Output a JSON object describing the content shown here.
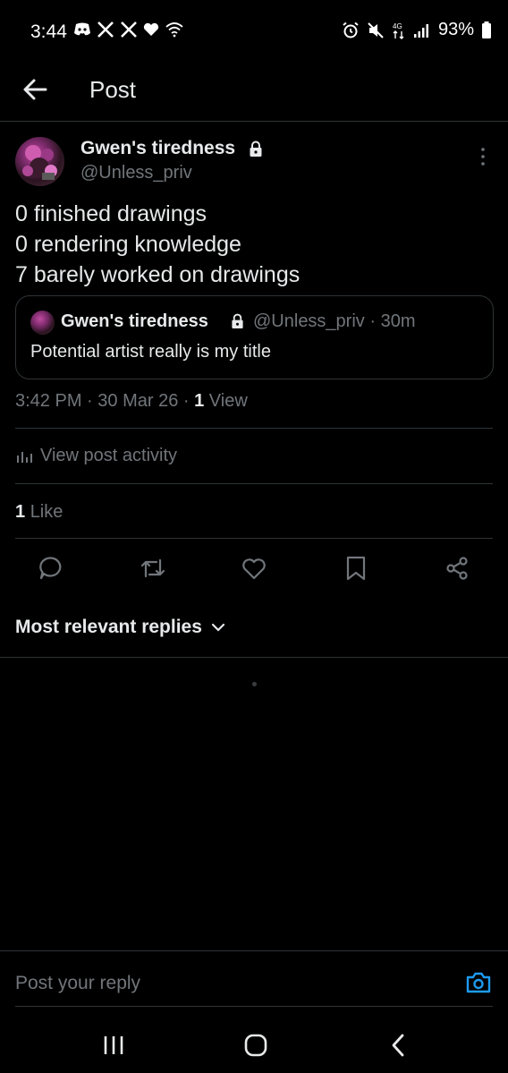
{
  "status_bar": {
    "time": "3:44",
    "battery": "93%",
    "left_icons": [
      "discord-icon",
      "x-icon",
      "x-icon",
      "heart-icon",
      "wifi-icon"
    ],
    "right_icons": [
      "alarm-icon",
      "mute-icon",
      "data-icon",
      "signal-icon",
      "battery-icon"
    ]
  },
  "header": {
    "title": "Post"
  },
  "post": {
    "author_name": "Gwen's tiredness",
    "author_handle": "@Unless_priv",
    "lines": [
      "0 finished drawings",
      "0 rendering knowledge",
      "7 barely worked on drawings"
    ],
    "quote": {
      "author_name": "Gwen's tiredness",
      "author_handle": "@Unless_priv",
      "time_ago": "· 30m",
      "text": "Potential artist really is my title"
    },
    "time": "3:42 PM",
    "date": "· 30 Mar 26 ·",
    "view_count": "1",
    "view_label": "View",
    "activity_label": "View post activity",
    "like_count": "1",
    "like_label": "Like"
  },
  "actions": [
    "reply-icon",
    "repost-icon",
    "like-icon",
    "bookmark-icon",
    "share-icon"
  ],
  "replies": {
    "sort_label": "Most relevant replies"
  },
  "reply_bar": {
    "placeholder": "Post your reply"
  },
  "colors": {
    "background": "#000000",
    "text": "#e7e9ea",
    "muted": "#71767b",
    "divider": "#2f3336",
    "accent": "#1d9bf0"
  }
}
